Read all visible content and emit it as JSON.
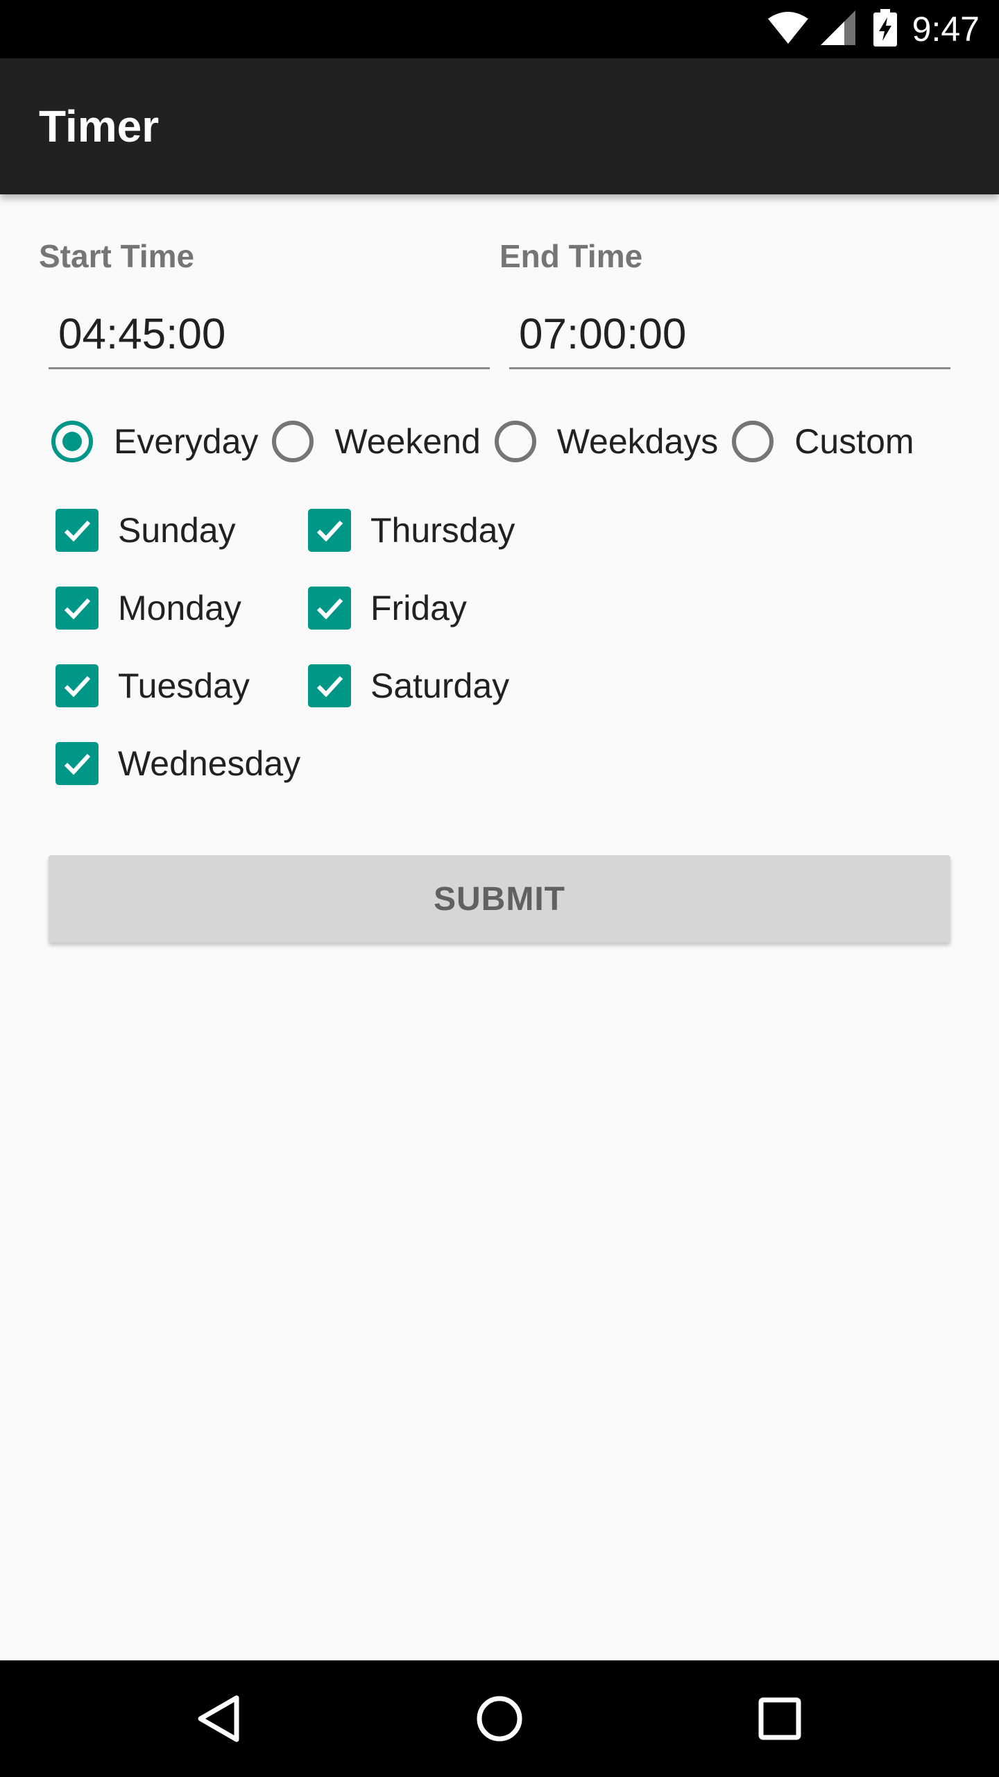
{
  "status_bar": {
    "time": "9:47",
    "icons": [
      "wifi-icon",
      "signal-icon",
      "battery-charging-icon"
    ]
  },
  "app_bar": {
    "title": "Timer"
  },
  "form": {
    "start_label": "Start Time",
    "start_value": "04:45:00",
    "end_label": "End Time",
    "end_value": "07:00:00",
    "repeat_options": [
      {
        "label": "Everyday",
        "checked": true
      },
      {
        "label": "Weekend",
        "checked": false
      },
      {
        "label": "Weekdays",
        "checked": false
      },
      {
        "label": "Custom",
        "checked": false
      }
    ],
    "days": [
      {
        "label": "Sunday",
        "checked": true
      },
      {
        "label": "Monday",
        "checked": true
      },
      {
        "label": "Tuesday",
        "checked": true
      },
      {
        "label": "Wednesday",
        "checked": true
      },
      {
        "label": "Thursday",
        "checked": true
      },
      {
        "label": "Friday",
        "checked": true
      },
      {
        "label": "Saturday",
        "checked": true
      }
    ],
    "submit_label": "SUBMIT"
  },
  "nav_bar": {
    "buttons": [
      "back-icon",
      "home-icon",
      "recents-icon"
    ]
  },
  "colors": {
    "accent": "#009688",
    "app_bar": "#212121",
    "background": "#fafafa",
    "button": "#d6d6d6"
  }
}
